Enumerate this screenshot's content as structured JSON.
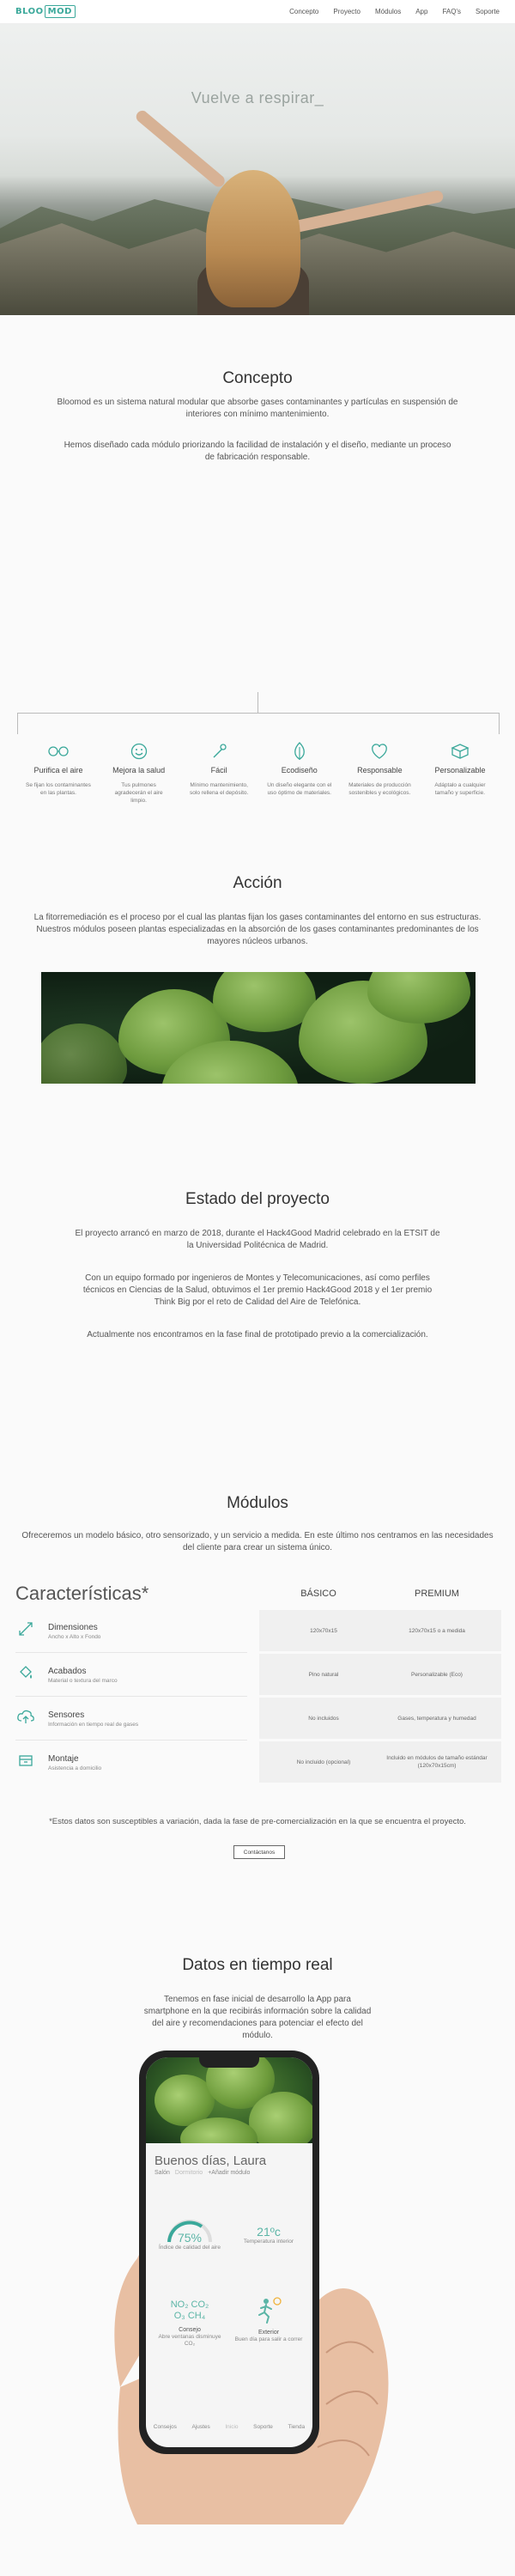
{
  "nav": {
    "logo_a": "BLOO",
    "logo_b": "MOD",
    "links": [
      "Concepto",
      "Proyecto",
      "Módulos",
      "App",
      "FAQ's",
      "Soporte"
    ]
  },
  "hero": {
    "title": "Vuelve a respirar_"
  },
  "concepto": {
    "title": "Concepto",
    "p1": "Bloomod es un sistema natural modular que absorbe gases contaminantes y partículas en suspensión de interiores con mínimo mantenimiento.",
    "p2": "Hemos diseñado cada módulo priorizando la facilidad de instalación y el diseño, mediante un proceso de fabricación responsable."
  },
  "features": [
    {
      "icon": "glasses-icon",
      "title": "Purifica el aire",
      "desc": "Se fijan los contaminantes en las plantas."
    },
    {
      "icon": "smile-icon",
      "title": "Mejora la salud",
      "desc": "Tus pulmones agradecerán el aire limpio."
    },
    {
      "icon": "tools-icon",
      "title": "Fácil",
      "desc": "Mínimo mantenimiento, solo rellena el depósito."
    },
    {
      "icon": "leaf-icon",
      "title": "Ecodiseño",
      "desc": "Un diseño elegante con el uso óptimo de materiales."
    },
    {
      "icon": "heart-icon",
      "title": "Responsable",
      "desc": "Materiales de producción sostenibles y ecológicos."
    },
    {
      "icon": "box-icon",
      "title": "Personalizable",
      "desc": "Adáptalo a cualquier tamaño y superficie."
    }
  ],
  "accion": {
    "title": "Acción",
    "p1": "La fitorremediación es el proceso por el cual las plantas fijan los gases contaminantes del entorno en sus estructuras. Nuestros módulos poseen plantas especializadas en la absorción de los gases contaminantes predominantes de los mayores núcleos urbanos."
  },
  "estado": {
    "title": "Estado del proyecto",
    "p1": "El proyecto arrancó en marzo de 2018, durante el Hack4Good Madrid celebrado en la ETSIT de la Universidad Politécnica de Madrid.",
    "p2": "Con un equipo formado por ingenieros de Montes y Telecomunicaciones, así como perfiles técnicos en Ciencias de la Salud, obtuvimos el 1er premio Hack4Good 2018 y el 1er premio Think Big por el reto de Calidad del Aire de Telefónica.",
    "p3": "Actualmente nos encontramos en la fase final de prototipado previo a la comercialización."
  },
  "modulos": {
    "title": "Módulos",
    "p1": "Ofreceremos un modelo básico, otro sensorizado, y un servicio a medida. En este último nos centramos en las necesidades del cliente para crear un sistema único."
  },
  "caracteristicas": {
    "title": "Características*",
    "col_basico": "BÁSICO",
    "col_premium": "PREMIUM",
    "rows": [
      {
        "icon": "dimensions-icon",
        "name": "Dimensiones",
        "sub": "Ancho x Alto x Fondo",
        "basico": "120x70x15",
        "premium": "120x70x15 o a medida"
      },
      {
        "icon": "paint-icon",
        "name": "Acabados",
        "sub": "Material o textura del marco",
        "basico": "Pino natural",
        "premium": "Personalizable (Eco)"
      },
      {
        "icon": "cloud-icon",
        "name": "Sensores",
        "sub": "Información en tiempo real de gases",
        "basico": "No incluidos",
        "premium": "Gases, temperatura y humedad"
      },
      {
        "icon": "wrench-icon",
        "name": "Montaje",
        "sub": "Asistencia a domicilio",
        "basico": "No incluido (opcional)",
        "premium": "Incluido en módulos de tamaño estándar (120x70x15cm)"
      }
    ],
    "note": "*Estos datos son susceptibles a variación, dada la fase de pre-comercialización en la que se encuentra el proyecto.",
    "button": "Contáctanos"
  },
  "datos": {
    "title": "Datos en tiempo real",
    "p1": "Tenemos en fase inicial de desarrollo la App para smartphone en la que recibirás información sobre la calidad del aire y recomendaciones para potenciar el efecto del módulo."
  },
  "app": {
    "greeting": "Buenos días, Laura",
    "rooms": [
      "Salón",
      "Dormitorio",
      "+Añadir módulo"
    ],
    "air_value": "75%",
    "air_label": "Índice de calidad del aire",
    "temp_value": "21ºc",
    "temp_label": "Temperatura interior",
    "gases": "NO₂ CO₂ O₃ CH₄",
    "consejo_title": "Consejo",
    "consejo_text": "Abre ventanas disminuye CO₂",
    "exterior_title": "Exterior",
    "exterior_text": "Buen día para salir a correr",
    "tabs": [
      "Consejos",
      "Ajustes",
      "Inicio",
      "Soporte",
      "Tienda"
    ]
  },
  "colors": {
    "accent": "#3aa89a"
  }
}
